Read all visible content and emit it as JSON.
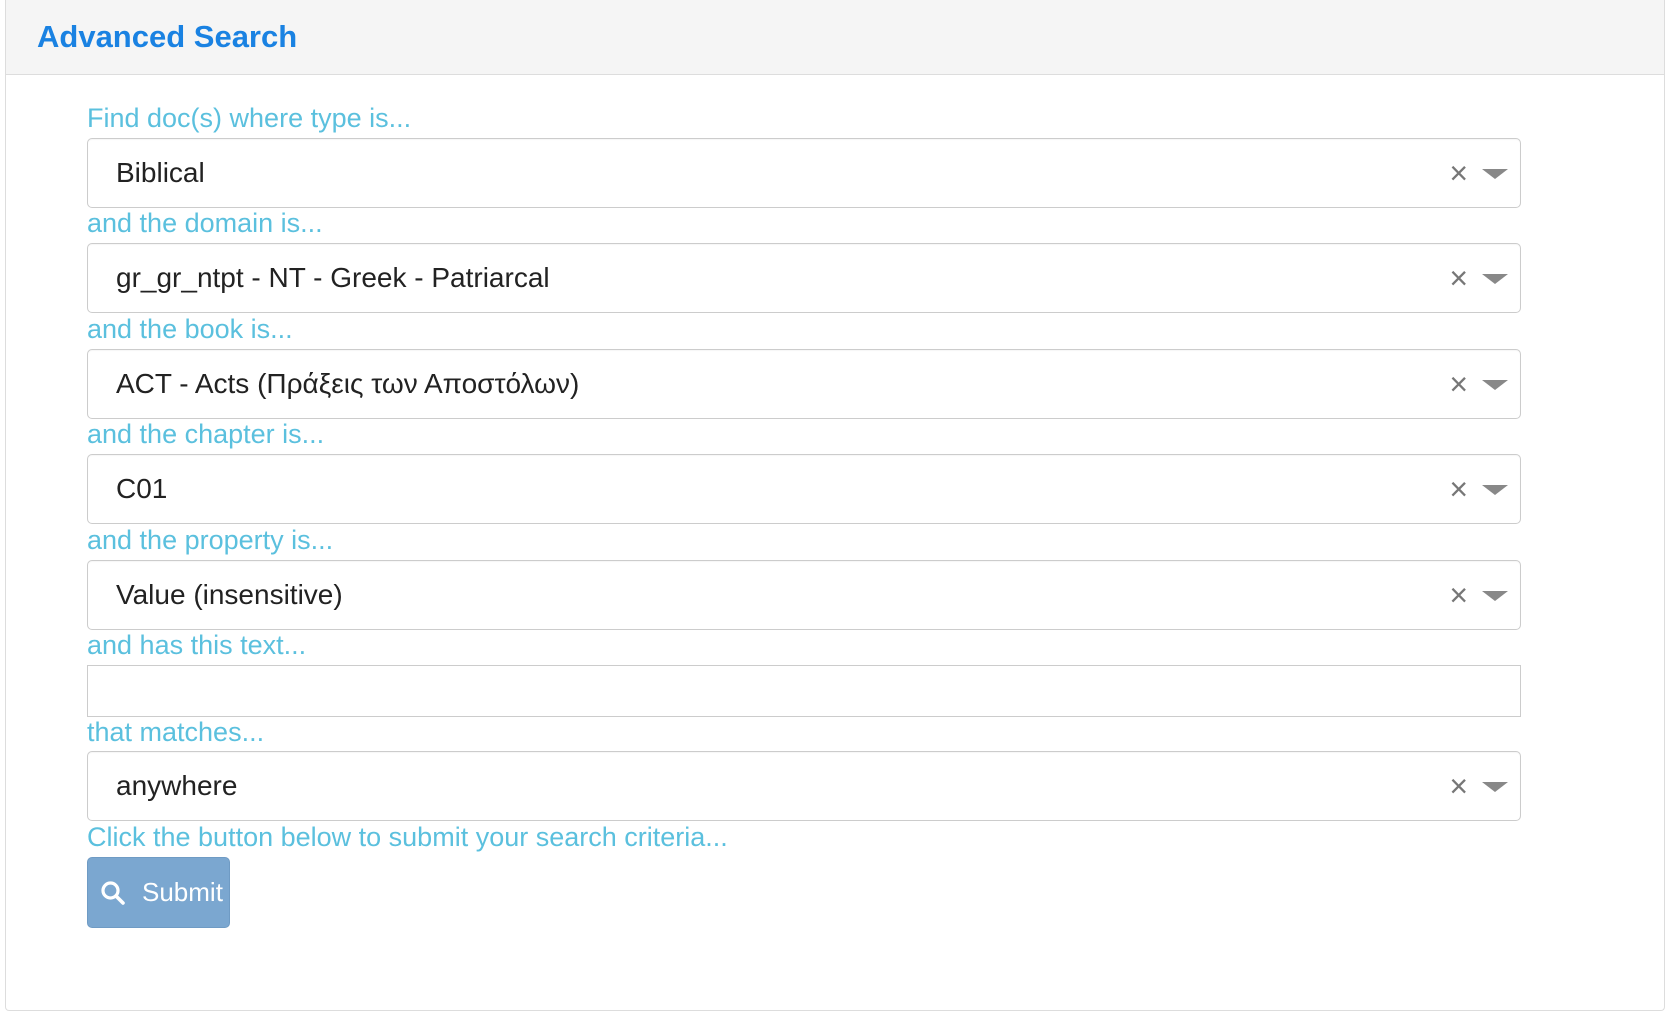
{
  "header": {
    "title": "Advanced Search"
  },
  "form": {
    "type": {
      "label": "Find doc(s) where type is...",
      "value": "Biblical"
    },
    "domain": {
      "label": "and the domain is...",
      "value": "gr_gr_ntpt - NT - Greek - Patriarcal"
    },
    "book": {
      "label": "and the book is...",
      "value": "ACT - Acts (Πράξεις των Αποστόλων)"
    },
    "chapter": {
      "label": "and the chapter is...",
      "value": "C01"
    },
    "property": {
      "label": "and the property is...",
      "value": "Value (insensitive)"
    },
    "text": {
      "label": "and has this text...",
      "value": ""
    },
    "matches": {
      "label": "that matches...",
      "value": "anywhere"
    },
    "submit_hint": "Click the button below to submit your search criteria...",
    "submit_label": "Submit"
  },
  "icons": {
    "clear": "close-icon",
    "dropdown": "caret-down-icon",
    "search": "search-icon"
  },
  "colors": {
    "title": "#1a82e2",
    "label": "#5bc0de",
    "button": "#7ba7d0"
  }
}
